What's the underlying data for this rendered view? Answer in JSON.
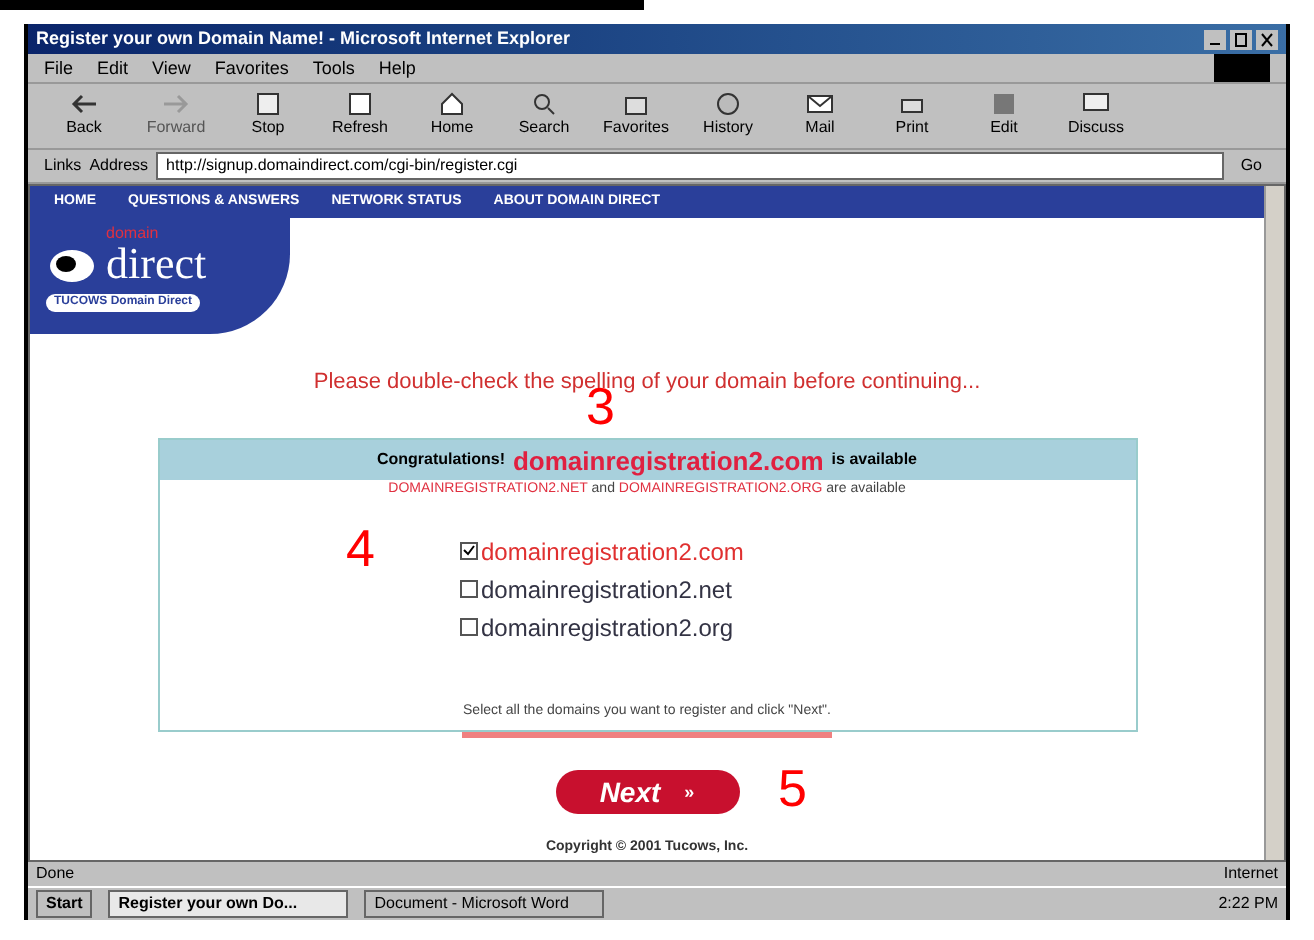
{
  "window": {
    "title": "Register your own Domain Name! - Microsoft Internet Explorer"
  },
  "menu": [
    "File",
    "Edit",
    "View",
    "Favorites",
    "Tools",
    "Help"
  ],
  "toolbar": [
    {
      "label": "Back",
      "kind": "back"
    },
    {
      "label": "Forward",
      "kind": "forward"
    },
    {
      "label": "Stop",
      "kind": "stop"
    },
    {
      "label": "Refresh",
      "kind": "refresh"
    },
    {
      "label": "Home",
      "kind": "home"
    },
    {
      "label": "Search",
      "kind": "search"
    },
    {
      "label": "Favorites",
      "kind": "favorites"
    },
    {
      "label": "History",
      "kind": "history"
    },
    {
      "label": "Mail",
      "kind": "mail"
    },
    {
      "label": "Print",
      "kind": "print"
    },
    {
      "label": "Edit",
      "kind": "edit"
    },
    {
      "label": "Discuss",
      "kind": "discuss"
    }
  ],
  "address_bar": {
    "label": "Address",
    "links_label": "Links",
    "value": "http://signup.domaindirect.com/cgi-bin/register.cgi",
    "go": "Go"
  },
  "site_nav": [
    "HOME",
    "QUESTIONS & ANSWERS",
    "NETWORK STATUS",
    "ABOUT DOMAIN DIRECT"
  ],
  "logo": {
    "top": "domain",
    "main": "direct",
    "tag": "TUCOWS Domain Direct"
  },
  "notice": "Please double-check the spelling of your domain before continuing...",
  "availability": {
    "prefix": "Congratulations!",
    "domain": "domainregistration2.com",
    "suffix": "is available",
    "others": "**DOMAINREGISTRATION2.NET** and **DOMAINREGISTRATION2.ORG** are available"
  },
  "domains": [
    {
      "label": "domainregistration2.com",
      "checked": true
    },
    {
      "label": "domainregistration2.net",
      "checked": false
    },
    {
      "label": "domainregistration2.org",
      "checked": false
    }
  ],
  "instruction": "Select all the domains you want to register and click \"Next\".",
  "next_button": {
    "label": "Next",
    "arrow": "»"
  },
  "copyright": "Copyright © 2001 Tucows, Inc.",
  "annotations": [
    "3",
    "4",
    "5"
  ],
  "status_bar": {
    "text": "Done",
    "zone": "Internet"
  },
  "taskbar": {
    "start": "Start",
    "tasks": [
      {
        "label": "Register your own Do...",
        "selected": true
      },
      {
        "label": "Document - Microsoft Word",
        "selected": false
      }
    ],
    "clock": "2:22 PM"
  }
}
